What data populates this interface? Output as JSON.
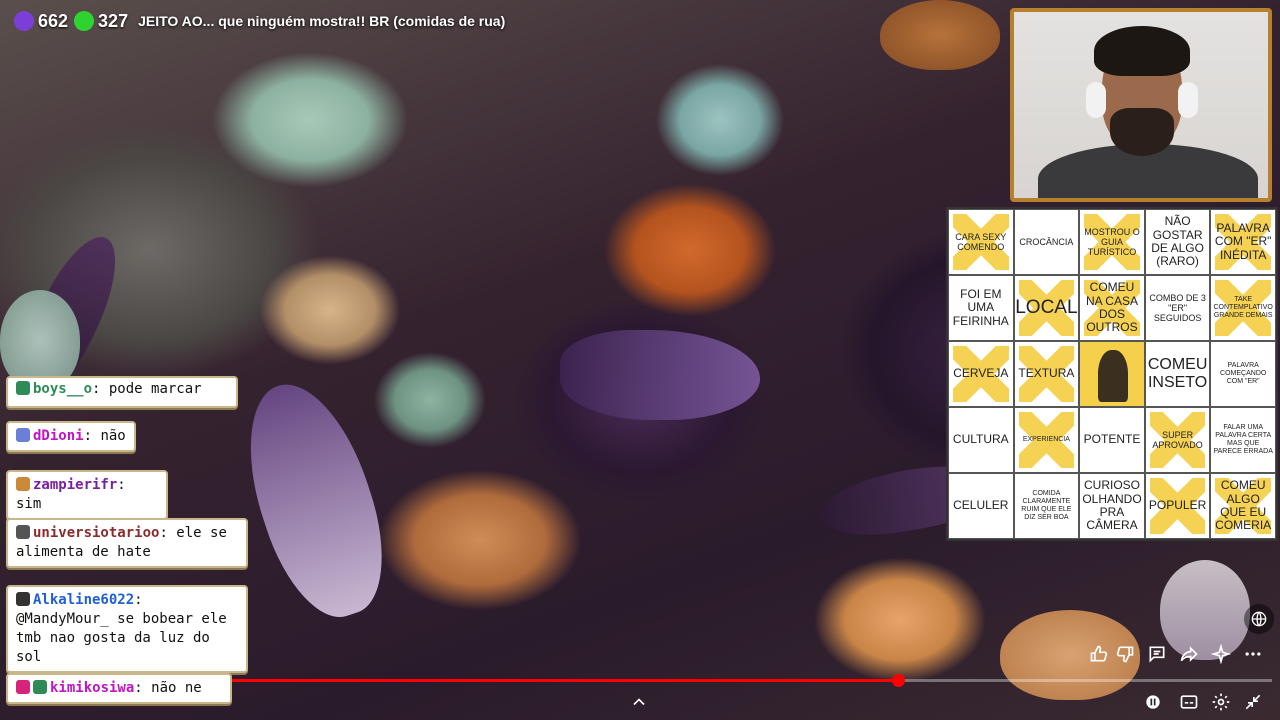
{
  "overlay": {
    "viewers_purple": "662",
    "viewers_green": "327",
    "title": "JEITO AO... que ninguém mostra!! BR (comidas de rua)",
    "purple_color": "#7b3fd8",
    "green_color": "#2fd32f"
  },
  "bingo": {
    "cells": [
      {
        "text": "CARA SEXY COMENDO",
        "marked": true
      },
      {
        "text": "CROCÂNCIA",
        "marked": false
      },
      {
        "text": "MOSTROU O GUIA TURÍSTICO",
        "marked": true
      },
      {
        "text": "NÃO GOSTAR DE ALGO (RARO)",
        "marked": false
      },
      {
        "text": "PALAVRA COM \"ER\" INÉDITA",
        "marked": true
      },
      {
        "text": "FOI EM UMA FEIRINHA",
        "marked": false
      },
      {
        "text": "LOCAL",
        "marked": true
      },
      {
        "text": "COMEU NA CASA DOS OUTROS",
        "marked": true
      },
      {
        "text": "COMBO DE 3 \"ER\" SEGUIDOS",
        "marked": false
      },
      {
        "text": "TAKE CONTEMPLATIVO GRANDE DEMAIS",
        "marked": true
      },
      {
        "text": "CERVEJA",
        "marked": true
      },
      {
        "text": "TEXTURA",
        "marked": true
      },
      {
        "text": "",
        "marked": true
      },
      {
        "text": "COMEU INSETO",
        "marked": false
      },
      {
        "text": "PALAVRA COMEÇANDO COM \"ER\"",
        "marked": false
      },
      {
        "text": "CULTURA",
        "marked": false
      },
      {
        "text": "EXPERIENCIA",
        "marked": true
      },
      {
        "text": "POTENTE",
        "marked": false
      },
      {
        "text": "SUPER APROVADO",
        "marked": true
      },
      {
        "text": "FALAR UMA PALAVRA CERTA MAS QUE PARECE ERRADA",
        "marked": false
      },
      {
        "text": "CELULER",
        "marked": false
      },
      {
        "text": "COMIDA CLARAMENTE RUIM QUE ELE DIZ SER BOA",
        "marked": false
      },
      {
        "text": "CURIOSO OLHANDO PRA CÂMERA",
        "marked": false
      },
      {
        "text": "POPULER",
        "marked": true
      },
      {
        "text": "COMEU ALGO QUE EU COMERIA",
        "marked": true
      }
    ]
  },
  "chat": [
    {
      "user": "boys__o",
      "text": "pode marcar",
      "color": "#2e8b57"
    },
    {
      "user": "dDioni",
      "text": "não",
      "color": "#c214c2"
    },
    {
      "user": "zampierifr",
      "text": "sim",
      "color": "#7a1fa2"
    },
    {
      "user": "universiotarioo",
      "text": "ele se alimenta de hate",
      "color": "#8b2b2b"
    },
    {
      "user": "Alkaline6022",
      "text": "@MandyMour_ se bobear ele tmb nao gosta da luz do sol",
      "color": "#1e5fd6"
    },
    {
      "user": "kimikosiwa",
      "text": "não ne",
      "color": "#c214c2"
    }
  ],
  "player": {
    "progress": 0.64,
    "accent": "#ff0000"
  },
  "icons": [
    "like-icon",
    "dislike-icon",
    "comment-icon",
    "share-icon",
    "sparkle-icon",
    "more-icon",
    "chevron-up-icon",
    "pause-icon",
    "subtitles-icon",
    "settings-icon",
    "minimize-icon",
    "globe-icon"
  ]
}
